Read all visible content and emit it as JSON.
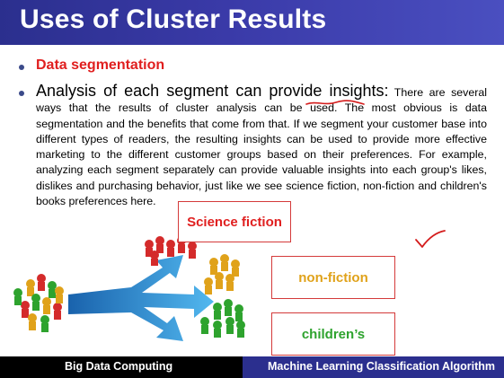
{
  "title": "Uses of Cluster Results",
  "bullets": {
    "first": "Data segmentation",
    "second_lead": "Analysis of each segment can provide insights:",
    "second_body": "There are several ways that the results of cluster analysis can be used. The most obvious is data segmentation and the benefits that come from that. If we segment your customer base into different types of readers, the resulting insights can be used to provide more effective marketing to the different customer groups based on their preferences. For example, analyzing each segment separately can provide valuable insights into each group's likes, dislikes and purchasing behavior, just like we see science fiction, non-fiction and children's books preferences here."
  },
  "boxes": {
    "science_fiction": "Science fiction",
    "non_fiction": "non-fiction",
    "childrens": "children’s"
  },
  "footer": {
    "left": "Big Data Computing",
    "right": "Machine Learning Classification Algorithm"
  },
  "colors": {
    "title_bar": "#2b2f8e",
    "accent_red": "#e01f1f",
    "orange": "#e0a21a",
    "green": "#2ea32e",
    "arrow_blue": "#1f8fd6"
  },
  "icons": {
    "annotation": "red-checkmark-icon",
    "illustration": "customer-segmentation-arrows"
  }
}
